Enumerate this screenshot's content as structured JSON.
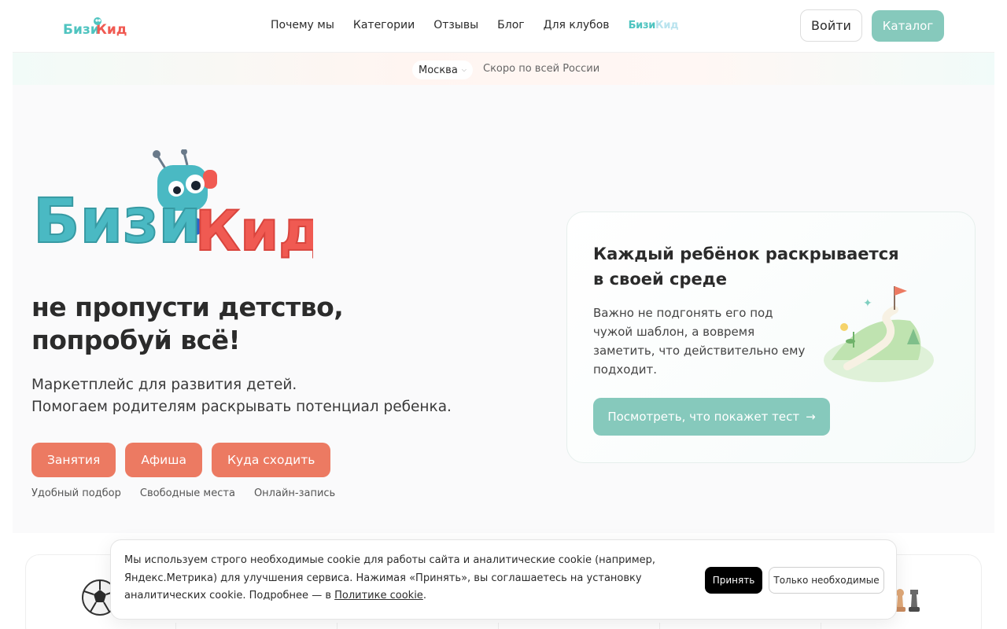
{
  "header": {
    "logo_alt": "БизиКид",
    "nav": [
      "Почему мы",
      "Категории",
      "Отзывы",
      "Блог",
      "Для клубов"
    ],
    "nav_logo_main": "Бизи",
    "nav_logo_tail": "Кид",
    "login_label": "Войти",
    "catalog_label": "Каталог"
  },
  "citybar": {
    "city": "Москва",
    "note": "Скоро по всей России"
  },
  "hero": {
    "logo_alt": "БизиКид",
    "headline_1": "не пропусти детство,",
    "headline_2": "попробуй всё!",
    "subtitle_1": "Маркетплейс для развития детей.",
    "subtitle_2": "Помогаем родителям раскрывать потенциал ребенка.",
    "cta": [
      "Занятия",
      "Афиша",
      "Куда сходить"
    ],
    "features": [
      "Удобный подбор",
      "Свободные места",
      "Онлайн-запись"
    ]
  },
  "test_card": {
    "title_1": "Каждый ребёнок раскрывается",
    "title_2": "в своей среде",
    "text": "Важно не подгонять его под чужой шаблон, а вовремя заметить, что действительно ему подходит.",
    "button": "Посмотреть, что покажет тест",
    "button_icon": "arrow-right-icon"
  },
  "cookie": {
    "text": "Мы используем строго необходимые cookie для работы сайта и аналитические cookie (например, Яндекс.Метрика) для улучшения сервиса. Нажимая «Принять», вы соглашаетесь на установку аналитических cookie. Подробнее — в ",
    "link": "Политике cookie",
    "after": ".",
    "accept": "Принять",
    "necessary": "Только необходимые"
  },
  "colors": {
    "accent_teal": "#86c9bc",
    "accent_coral": "#ec7a62",
    "logo_teal": "#4fc4c0",
    "logo_red": "#f05a52"
  }
}
